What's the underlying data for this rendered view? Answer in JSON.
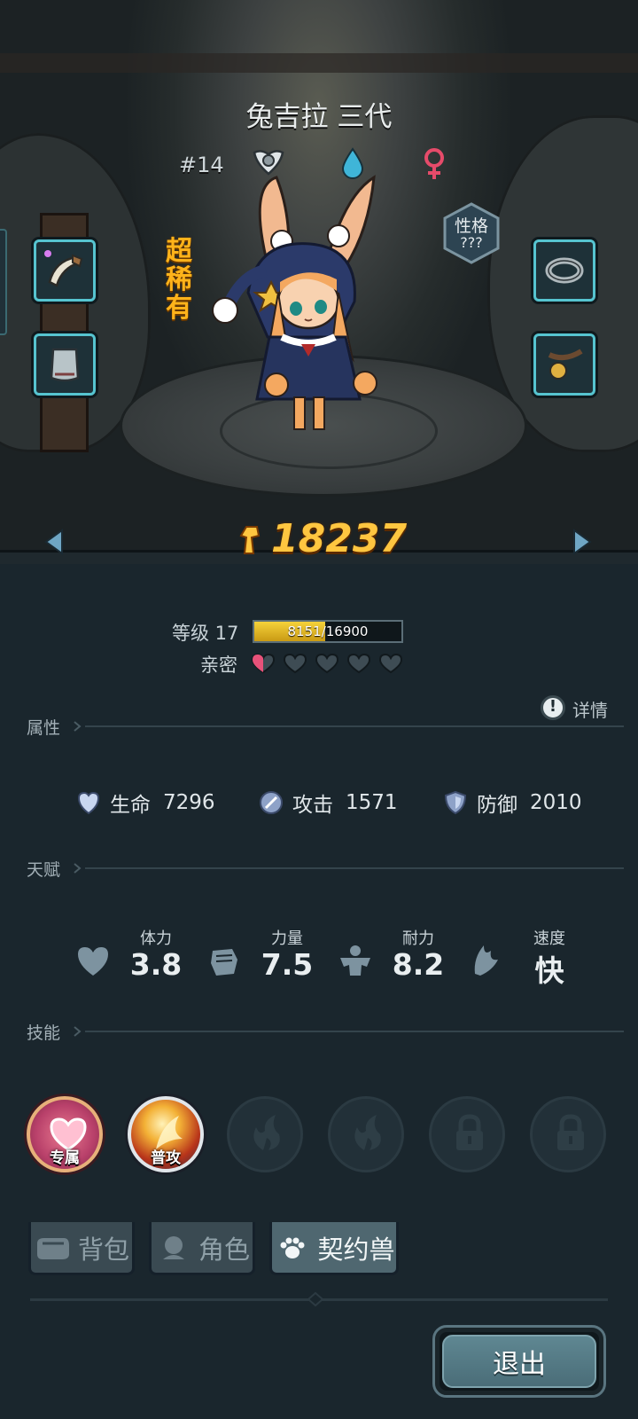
{
  "character": {
    "name": "兔吉拉 三代",
    "number": "#14",
    "rarity": "超稀有",
    "personality_label": "性格",
    "personality_value": "???",
    "power": "18237"
  },
  "level": {
    "label": "等级 17",
    "progress_text": "8151/16900",
    "progress_fraction": 0.482
  },
  "affinity": {
    "label": "亲密",
    "hearts_total": 5,
    "hearts_filled": 0.5
  },
  "details_label": "详情",
  "sections": {
    "attributes": "属性",
    "talent": "天赋",
    "skills": "技能"
  },
  "attributes": [
    {
      "label": "生命",
      "value": "7296",
      "icon": "heart-shield-icon"
    },
    {
      "label": "攻击",
      "value": "1571",
      "icon": "sword-icon"
    },
    {
      "label": "防御",
      "value": "2010",
      "icon": "shield-icon"
    }
  ],
  "talents": [
    {
      "label": "体力",
      "value": "3.8",
      "icon": "heart-icon"
    },
    {
      "label": "力量",
      "value": "7.5",
      "icon": "fist-icon"
    },
    {
      "label": "耐力",
      "value": "8.2",
      "icon": "muscle-icon"
    },
    {
      "label": "速度",
      "value": "快",
      "icon": "wing-icon"
    }
  ],
  "skills": [
    {
      "label": "专属",
      "type": "exclusive"
    },
    {
      "label": "普攻",
      "type": "attack"
    },
    {
      "label": "",
      "type": "empty-flame"
    },
    {
      "label": "",
      "type": "empty-flame"
    },
    {
      "label": "",
      "type": "locked"
    },
    {
      "label": "",
      "type": "locked"
    }
  ],
  "tabs": [
    {
      "label": "背包",
      "active": false
    },
    {
      "label": "角色",
      "active": false
    },
    {
      "label": "契约兽",
      "active": true
    }
  ],
  "exit_label": "退出",
  "colors": {
    "accent_gold": "#ffc640",
    "rarity_orange": "#ffb31a",
    "equip_border": "#56c4d0",
    "panel_bg": "#1a262d",
    "affinity_pink": "#e8527a"
  }
}
